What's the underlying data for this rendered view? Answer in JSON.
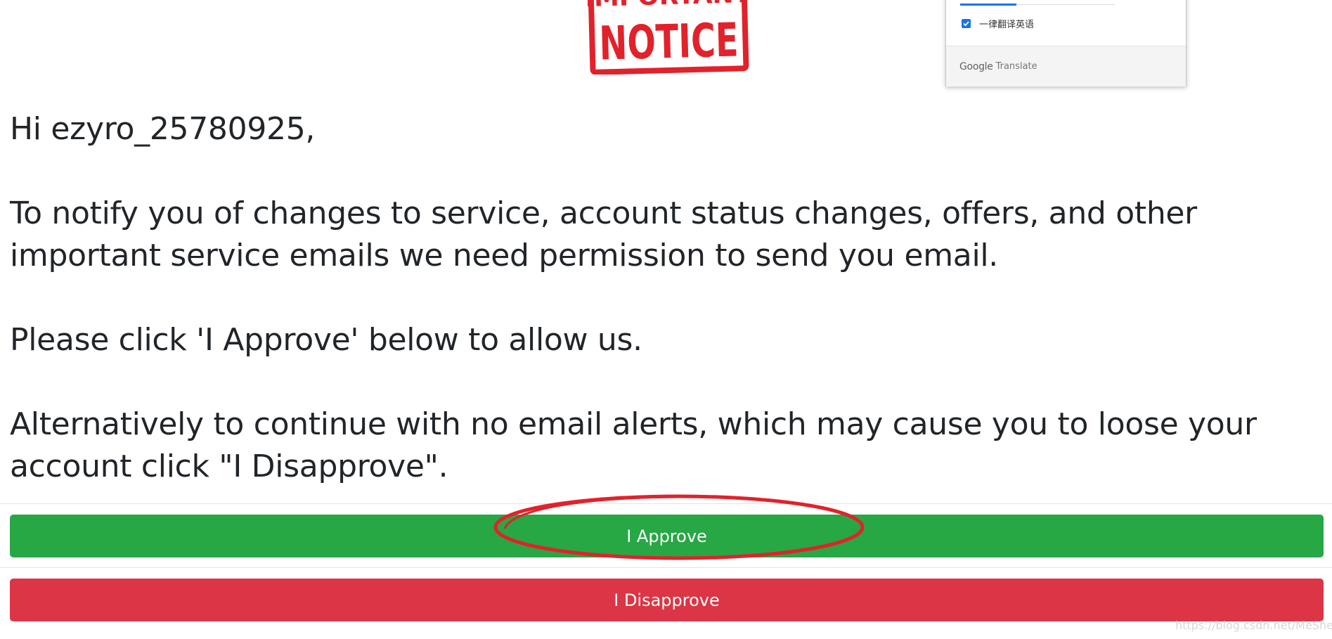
{
  "stamp": {
    "top_text": "IMPORTANT",
    "main_text": "NOTICE",
    "color": "#e1222b"
  },
  "translate_popup": {
    "checkbox_label": "一律翻译英语",
    "checkbox_checked": true,
    "brand_google": "Google",
    "brand_translate": "Translate"
  },
  "message": {
    "greeting": "Hi ezyro_25780925,",
    "paragraph1": "To notify you of changes to service, account status changes, offers, and other important service emails we need permission to send you email.",
    "paragraph2": "Please click 'I Approve' below to allow us.",
    "paragraph3": "Alternatively to continue with no email alerts, which may cause you to loose your account click \"I Disapprove\"."
  },
  "buttons": {
    "approve_label": "I Approve",
    "approve_color": "#28a745",
    "disapprove_label": "I Disapprove",
    "disapprove_color": "#dc3545"
  },
  "annotation": {
    "highlight_color": "#e1222b"
  },
  "watermark": "https://blog.csdn.net/MeSheep"
}
